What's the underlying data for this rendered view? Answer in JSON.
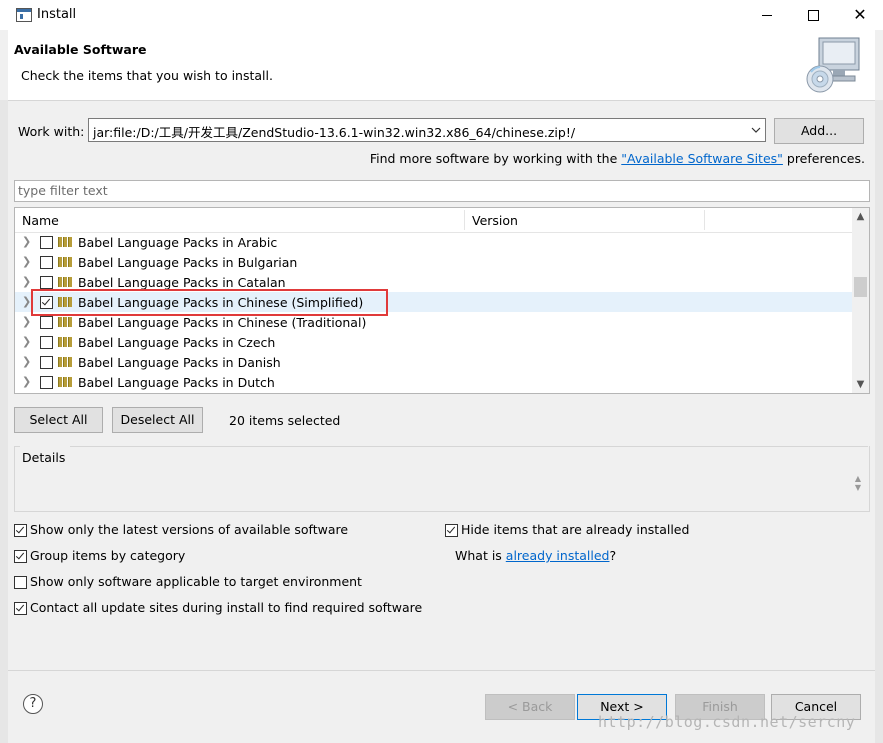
{
  "window": {
    "title": "Install",
    "app_icon": "window-icon",
    "close_glyph": "✕"
  },
  "banner": {
    "title": "Available Software",
    "subtitle": "Check the items that you wish to install.",
    "icon": "install-cd-computer-icon"
  },
  "work_with": {
    "label": "Work with:",
    "value": "jar:file:/D:/工具/开发工具/ZendStudio-13.6.1-win32.win32.x86_64/chinese.zip!/",
    "add_label": "Add...",
    "more_prefix": "Find more software by working with the ",
    "more_link": "\"Available Software Sites\"",
    "more_suffix": " preferences."
  },
  "filter": {
    "placeholder": "type filter text"
  },
  "table": {
    "columns": {
      "name": "Name",
      "version": "Version"
    },
    "rows": [
      {
        "label": "Babel Language Packs in Arabic",
        "checked": false
      },
      {
        "label": "Babel Language Packs in Bulgarian",
        "checked": false
      },
      {
        "label": "Babel Language Packs in Catalan",
        "checked": false
      },
      {
        "label": "Babel Language Packs in Chinese (Simplified)",
        "checked": true,
        "selected": true
      },
      {
        "label": "Babel Language Packs in Chinese (Traditional)",
        "checked": false
      },
      {
        "label": "Babel Language Packs in Czech",
        "checked": false
      },
      {
        "label": "Babel Language Packs in Danish",
        "checked": false
      },
      {
        "label": "Babel Language Packs in Dutch",
        "checked": false
      }
    ]
  },
  "selection": {
    "select_all": "Select All",
    "deselect_all": "Deselect All",
    "count_text": "20 items selected"
  },
  "details": {
    "legend": "Details"
  },
  "options": {
    "latest_versions": {
      "label": "Show only the latest versions of available software",
      "checked": true
    },
    "group_by_category": {
      "label": "Group items by category",
      "checked": true
    },
    "target_env": {
      "label": "Show only software applicable to target environment",
      "checked": false
    },
    "contact_sites": {
      "label": "Contact all update sites during install to find required software",
      "checked": true
    },
    "hide_installed": {
      "label": "Hide items that are already installed",
      "checked": true
    },
    "what_is_prefix": "What is ",
    "what_is_link": "already installed",
    "what_is_suffix": "?"
  },
  "footer": {
    "help": "?",
    "back": "< Back",
    "next": "Next >",
    "finish": "Finish",
    "cancel": "Cancel"
  },
  "watermark": "http://blog.csdn.net/sercny",
  "colors": {
    "accent": "#0078d7",
    "link": "#0066cc",
    "highlight_box": "#e03a3a",
    "selected_row": "#e5f1fb"
  }
}
